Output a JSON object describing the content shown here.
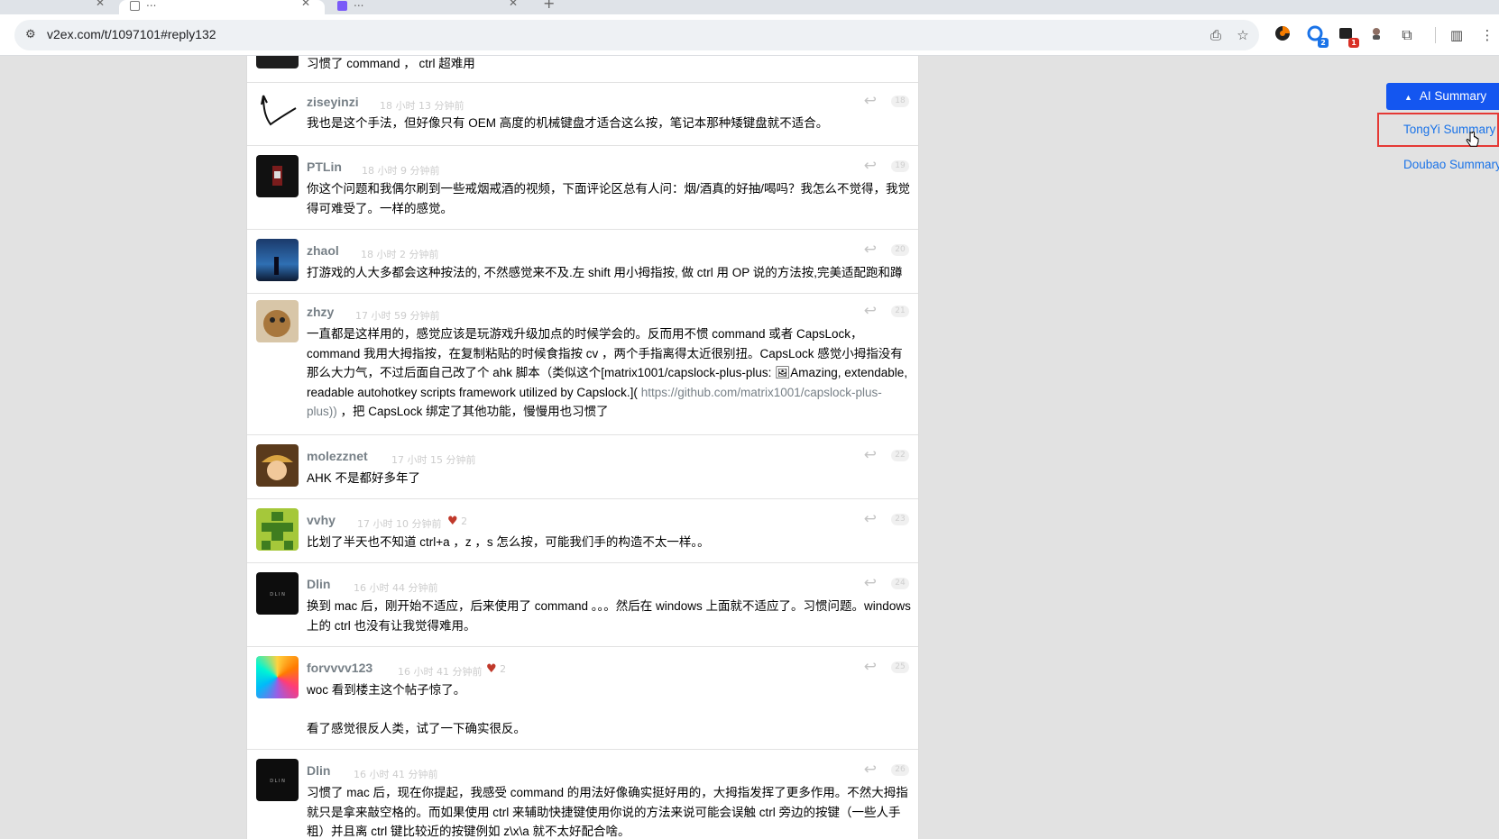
{
  "browser": {
    "tabs": [
      {
        "title": ""
      },
      {
        "title": "..."
      },
      {
        "title": "..."
      }
    ],
    "url": "v2ex.com/t/1097101#reply132"
  },
  "extensions": [
    {
      "name": "extension-1-icon",
      "badge": ""
    },
    {
      "name": "extension-2-icon",
      "badge": "2",
      "badge_color": "#1a73e8"
    },
    {
      "name": "extension-3-icon",
      "badge": "1",
      "badge_color": "#d93025"
    },
    {
      "name": "extension-4-icon",
      "badge": ""
    }
  ],
  "replies": [
    {
      "content": [
        "习惯了 command ， ctrl 超难用"
      ]
    },
    {
      "username": "ziseyinzi",
      "time": "18 小时 13 分钟前",
      "floor": "18",
      "content": [
        "我也是这个手法，但好像只有 OEM 高度的机械键盘才适合这么按，笔记本那种矮键盘就不适合。"
      ]
    },
    {
      "username": "PTLin",
      "time": "18 小时 9 分钟前",
      "floor": "19",
      "content": [
        "你这个问题和我偶尔刷到一些戒烟戒酒的视频，下面评论区总有人问：烟/酒真的好抽/喝吗？我怎么不觉得，我觉得可难受了。一样的感觉。"
      ]
    },
    {
      "username": "zhaol",
      "time": "18 小时 2 分钟前",
      "floor": "20",
      "content": [
        "打游戏的人大多都会这种按法的, 不然感觉来不及.左 shift 用小拇指按, 做 ctrl 用 OP 说的方法按,完美适配跑和蹲"
      ]
    },
    {
      "username": "zhzy",
      "time": "17 小时 59 分钟前",
      "floor": "21",
      "content": [
        "一直都是这样用的，感觉应该是玩游戏升级加点的时候学会的。反而用不惯 command 或者 CapsLock，command 我用大拇指按，在复制粘贴的时候食指按 cv ，两个手指离得太近很别扭。CapsLock 感觉小拇指没有那么大力气，不过后面自己改了个 ahk 脚本（类似这个[matrix1001/capslock-plus-plus: 🖼Amazing, extendable, readable autohotkey scripts framework utilized by Capslock.]("
      ],
      "link": "https://github.com/matrix1001/capslock-plus-plus))",
      "tail": "，把 CapsLock 绑定了其他功能，慢慢用也习惯了"
    },
    {
      "username": "molezznet",
      "time": "17 小时 15 分钟前",
      "floor": "22",
      "content": [
        "AHK 不是都好多年了"
      ]
    },
    {
      "username": "vvhy",
      "time": "17 小时 10 分钟前",
      "likes": "2",
      "floor": "23",
      "content": [
        "比划了半天也不知道 ctrl+a ，z ，s 怎么按，可能我们手的构造不太一样。。"
      ]
    },
    {
      "username": "Dlin",
      "time": "16 小时 44 分钟前",
      "floor": "24",
      "content": [
        "换到 mac 后，刚开始不适应，后来使用了 command 。。。然后在 windows 上面就不适应了。习惯问题。windows 上的 ctrl 也没有让我觉得难用。"
      ]
    },
    {
      "username": "forvvvv123",
      "time": "16 小时 41 分钟前",
      "likes": "2",
      "floor": "25",
      "content": [
        "woc 看到楼主这个帖子惊了。",
        "",
        "看了感觉很反人类，试了一下确实很反。"
      ]
    },
    {
      "username": "Dlin",
      "time": "16 小时 41 分钟前",
      "floor": "26",
      "content": [
        "习惯了 mac 后，现在你提起，我感受 command 的用法好像确实挺好用的，大拇指发挥了更多作用。不然大拇指就只是拿来敲空格的。而如果使用 ctrl 来辅助快捷键使用你说的方法来说可能会误触 ctrl 旁边的按键（一些人手粗）并且离 ctrl 键比较近的按键例如 z\\x\\a 就不太好配合啥。"
      ]
    }
  ],
  "ai_panel": {
    "button_label": "AI Summary",
    "items": [
      "TongYi Summary",
      "Doubao Summary"
    ]
  }
}
